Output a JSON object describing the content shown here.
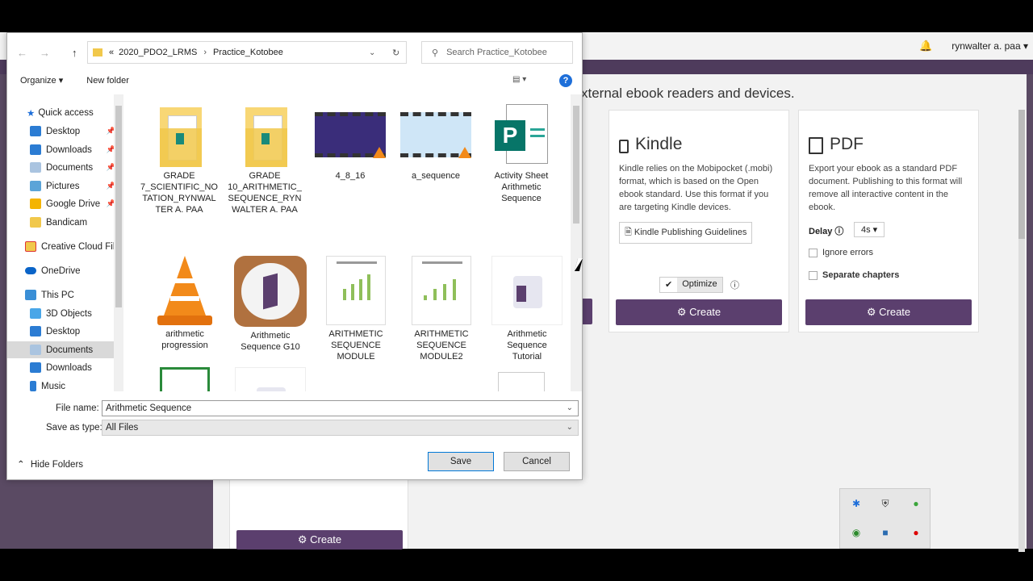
{
  "web": {
    "user": "rynwalter a. paa",
    "heading": "xternal ebook readers and devices.",
    "kindle": {
      "title": "Kindle",
      "description": "Kindle relies on the Mobipocket (.mobi) format, which is based on the Open ebook standard. Use this format if you are targeting Kindle devices.",
      "guidelines_label": "Kindle Publishing Guidelines",
      "optimize_label": "Optimize",
      "create_label": "Create"
    },
    "pdf": {
      "title": "PDF",
      "description": "Export your ebook as a standard PDF document. Publishing to this format will remove all interactive content in the ebook.",
      "delay_label": "Delay",
      "delay_value": "4s",
      "ignore_errors_label": "Ignore errors",
      "separate_chapters_label": "Separate chapters",
      "create_label": "Create"
    },
    "bottom_create_label": "Create"
  },
  "dialog": {
    "path": [
      "2020_PDO2_LRMS",
      "Practice_Kotobee"
    ],
    "path_prefix": "«",
    "search_placeholder": "Search Practice_Kotobee",
    "organize_label": "Organize",
    "new_folder_label": "New folder",
    "nav": {
      "quick_access": "Quick access",
      "items": [
        "Desktop",
        "Downloads",
        "Documents",
        "Pictures",
        "Google Drive",
        "Bandicam",
        "Creative Cloud Fil",
        "OneDrive",
        "This PC",
        "3D Objects",
        "Desktop",
        "Documents",
        "Downloads",
        "Music"
      ]
    },
    "files": [
      {
        "name": "GRADE 7_SCIENTIFIC_NO TATION_RYNWAL TER A. PAA",
        "lines": [
          "GRADE",
          "7_SCIENTIFIC_NO",
          "TATION_RYNWAL",
          "TER A. PAA"
        ]
      },
      {
        "name": "GRADE 10_ARITHMETIC_ SEQUENCE_RYN WALTER A. PAA",
        "lines": [
          "GRADE",
          "10_ARITHMETIC_",
          "SEQUENCE_RYN",
          "WALTER A. PAA"
        ]
      },
      {
        "name": "4_8_16",
        "lines": [
          "4_8_16"
        ]
      },
      {
        "name": "a_sequence",
        "lines": [
          "a_sequence"
        ]
      },
      {
        "name": "Activity Sheet Arithmetic Sequence",
        "lines": [
          "Activity Sheet",
          "Arithmetic",
          "Sequence"
        ]
      },
      {
        "name": "arithmetic progression",
        "lines": [
          "arithmetic",
          "progression"
        ]
      },
      {
        "name": "Arithmetic Sequence G10",
        "lines": [
          "Arithmetic",
          "Sequence G10"
        ]
      },
      {
        "name": "ARITHMETIC SEQUENCE MODULE",
        "lines": [
          "ARITHMETIC",
          "SEQUENCE",
          "MODULE"
        ]
      },
      {
        "name": "ARITHMETIC SEQUENCE MODULE2",
        "lines": [
          "ARITHMETIC",
          "SEQUENCE",
          "MODULE2"
        ]
      },
      {
        "name": "Arithmetic Sequence Tutorial",
        "lines": [
          "Arithmetic",
          "Sequence",
          "Tutorial"
        ]
      }
    ],
    "file_name_label": "File name:",
    "file_name_value": "Arithmetic Sequence",
    "save_type_label": "Save as type:",
    "save_type_value": "All Files",
    "save_label": "Save",
    "cancel_label": "Cancel",
    "hide_folders_label": "Hide Folders"
  },
  "colors": {
    "accent_purple": "#5b3f6e",
    "folder_yellow": "#f1c84b",
    "windows_blue": "#0078d7"
  }
}
